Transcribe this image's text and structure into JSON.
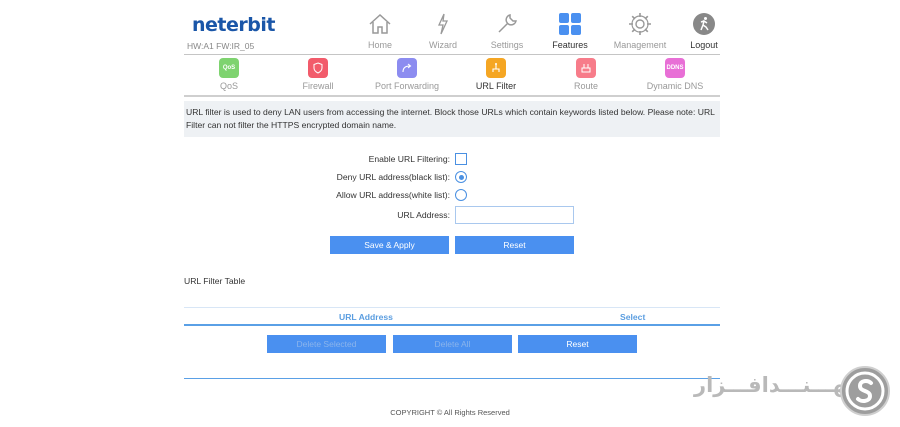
{
  "brand": {
    "logo": "neterbit",
    "hw_fw": "HW:A1 FW:IR_05"
  },
  "topnav": [
    {
      "label": "Home",
      "icon": "home-icon"
    },
    {
      "label": "Wizard",
      "icon": "wizard-icon"
    },
    {
      "label": "Settings",
      "icon": "wrench-icon"
    },
    {
      "label": "Features",
      "icon": "grid-icon",
      "active": true
    },
    {
      "label": "Management",
      "icon": "gear-icon"
    },
    {
      "label": "Logout",
      "icon": "logout-icon"
    }
  ],
  "subnav": [
    {
      "label": "QoS",
      "icon_text": "QoS",
      "color": "#7ed36f"
    },
    {
      "label": "Firewall",
      "color": "#f25b6b"
    },
    {
      "label": "Port Forwarding",
      "color": "#8c8cf0"
    },
    {
      "label": "URL Filter",
      "color": "#f5a623",
      "active": true
    },
    {
      "label": "Route",
      "color": "#f77c8a"
    },
    {
      "label": "Dynamic DNS",
      "icon_text": "DDNS",
      "color": "#e86fd6"
    }
  ],
  "description": "URL filter is used to deny LAN users from accessing the internet. Block those URLs which contain keywords listed below. Please note: URL Filter can not filter the HTTPS encrypted domain name.",
  "form": {
    "enable_label": "Enable URL Filtering:",
    "enable_checked": false,
    "deny_label": "Deny URL address(black list):",
    "allow_label": "Allow URL address(white list):",
    "selected_mode": "deny",
    "url_label": "URL Address:",
    "url_value": ""
  },
  "buttons": {
    "save": "Save & Apply",
    "reset": "Reset"
  },
  "table": {
    "title": "URL Filter Table",
    "columns": [
      "URL Address",
      "Select"
    ],
    "rows": []
  },
  "table_buttons": {
    "delete_selected": "Delete Selected",
    "delete_all": "Delete All",
    "reset": "Reset"
  },
  "footer": {
    "copyright": "COPYRIGHT © All Rights Reserved"
  },
  "watermark": {
    "text": "ســـهـــنـــدافـــزار",
    "mark": "S"
  },
  "colors": {
    "accent": "#4a90f0",
    "table_head": "#5a9de0",
    "brand": "#1a56a8"
  }
}
